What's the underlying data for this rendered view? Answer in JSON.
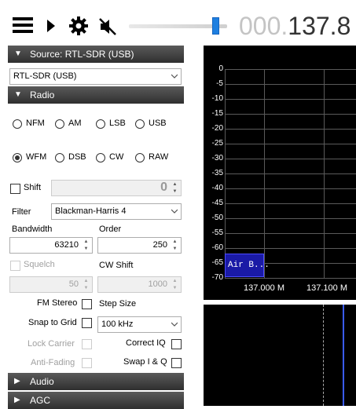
{
  "toolbar": {
    "menu_icon": "hamburger-menu-icon",
    "play_icon": "play-icon",
    "settings_icon": "gear-icon",
    "mute_icon": "speaker-muted-icon",
    "freq_dim": "000.",
    "freq_bright": "137.8"
  },
  "source": {
    "header": "Source: RTL-SDR (USB)",
    "device": "RTL-SDR (USB)"
  },
  "radio": {
    "header": "Radio",
    "modes_row1": [
      "NFM",
      "AM",
      "LSB",
      "USB"
    ],
    "modes_row2": [
      "WFM",
      "DSB",
      "CW",
      "RAW"
    ],
    "selected_mode": "WFM",
    "shift_label": "Shift",
    "shift_value": "0",
    "filter_label": "Filter",
    "filter_value": "Blackman-Harris 4",
    "bandwidth_label": "Bandwidth",
    "bandwidth_value": "63210",
    "order_label": "Order",
    "order_value": "250",
    "squelch_label": "Squelch",
    "squelch_value": "50",
    "cwshift_label": "CW Shift",
    "cwshift_value": "1000",
    "fmstereo_label": "FM Stereo",
    "stepsize_label": "Step Size",
    "snap_label": "Snap to Grid",
    "step_value": "100 kHz",
    "lockcarrier_label": "Lock Carrier",
    "correctiq_label": "Correct IQ",
    "antifading_label": "Anti-Fading",
    "swapiq_label": "Swap I & Q"
  },
  "audio": {
    "header": "Audio"
  },
  "agc": {
    "header": "AGC"
  },
  "spectrum": {
    "y_ticks": [
      "0",
      "-5",
      "-10",
      "-15",
      "-20",
      "-25",
      "-30",
      "-35",
      "-40",
      "-45",
      "-50",
      "-55",
      "-60",
      "-65",
      "-70"
    ],
    "x_ticks": [
      "137.000 M",
      "137.100 M"
    ],
    "band_label": "Air B..."
  },
  "colors": {
    "header_bg": "#3c3c3c",
    "band_blue": "#1a1aa6",
    "cursor_blue": "#3a5cff"
  }
}
